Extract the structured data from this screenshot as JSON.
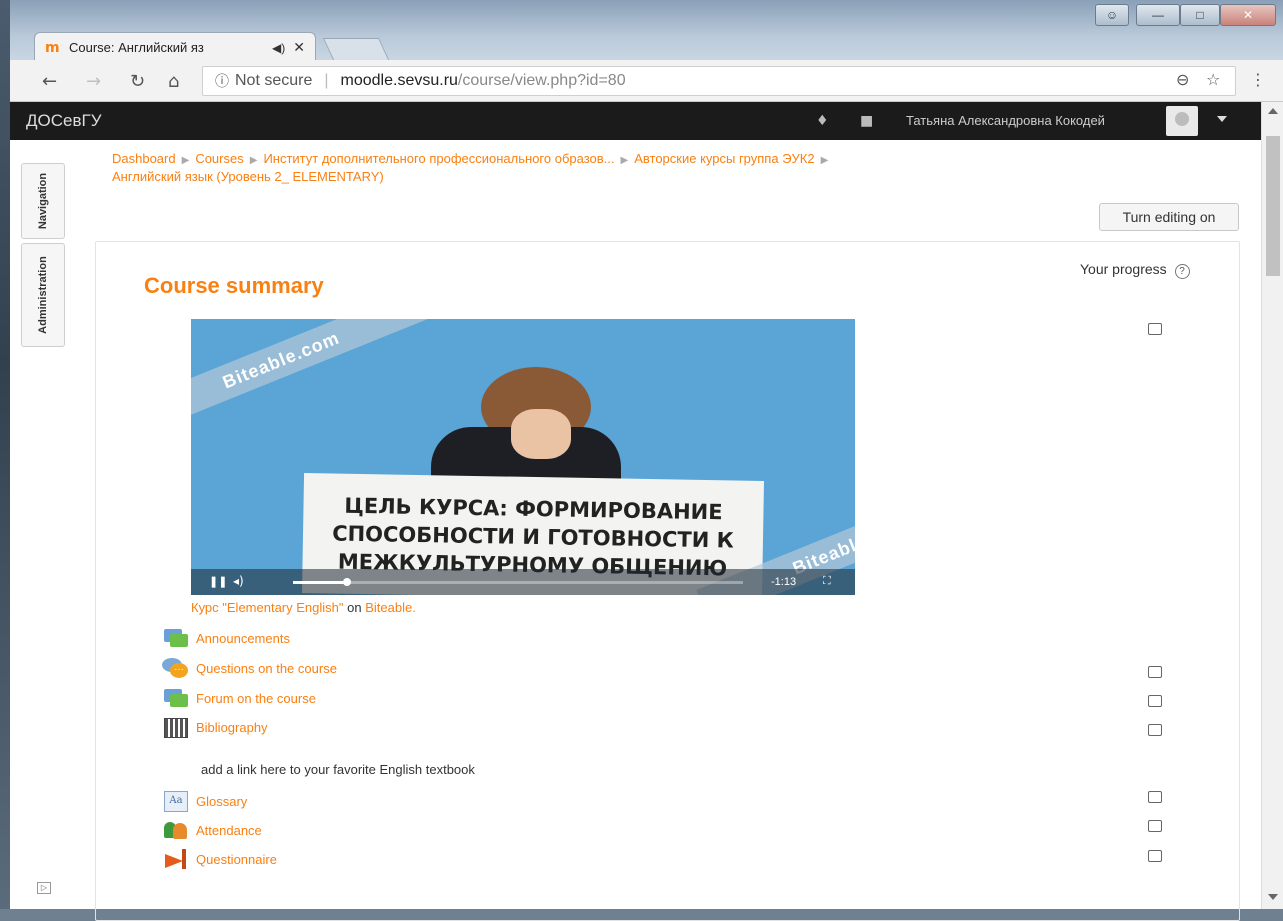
{
  "browser": {
    "tab_title": "Course: Английский яз",
    "audio_icon": "speaker-icon",
    "close_label": "✕",
    "favicon_text": "m",
    "url_security": "Not secure",
    "url_host": "moodle.sevsu.ru",
    "url_path": "/course/view.php?id=80"
  },
  "navbar": {
    "brand": "ДОСевГУ",
    "user_name": "Татьяна Александровна Кокодей"
  },
  "blocks": {
    "navigation": "Navigation",
    "administration": "Administration"
  },
  "breadcrumb": [
    "Dashboard",
    "Courses",
    "Институт дополнительного профессионального образов...",
    "Авторские курсы группа ЭУК2",
    "Английский язык (Уровень 2_ ELEMENTARY)"
  ],
  "editing_button": "Turn editing on",
  "summary": {
    "title": "Course summary",
    "progress_label": "Your progress",
    "progress_help": "?"
  },
  "video": {
    "watermark": "Biteable.com",
    "sign_lines": [
      "ЦЕЛЬ КУРСА: ФОРМИРОВАНИЕ",
      "СПОСОБНОСТИ И ГОТОВНОСТИ К",
      "МЕЖКУЛЬТУРНОМУ ОБЩЕНИЮ"
    ],
    "time_remaining": "-1:13",
    "progress_fraction": 0.12
  },
  "caption": {
    "link": "Курс \"Elementary English\"",
    "on": "on",
    "source": "Biteable."
  },
  "activities": [
    {
      "label": "Announcements",
      "icon": "forum-icon"
    },
    {
      "label": "Questions on the course",
      "icon": "question-forum-icon"
    },
    {
      "label": "Forum on the course",
      "icon": "forum-icon"
    },
    {
      "label": "Bibliography",
      "icon": "bibliography-icon"
    },
    {
      "label": "Glossary",
      "icon": "glossary-icon"
    },
    {
      "label": "Attendance",
      "icon": "attendance-icon"
    },
    {
      "label": "Questionnaire",
      "icon": "questionnaire-icon"
    }
  ],
  "bibliography_note": "add a link here to your favorite English textbook",
  "colors": {
    "accent": "#f98012",
    "navbar": "#1b1b1b"
  }
}
